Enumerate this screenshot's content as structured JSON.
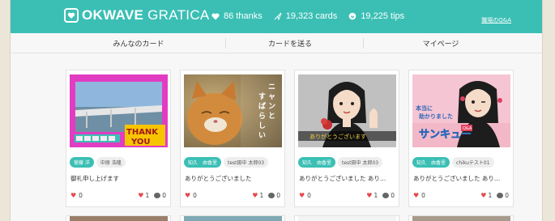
{
  "header": {
    "logo_bold": "OKWAVE",
    "logo_light": "GRATICA",
    "thanks": "86 thanks",
    "cards": "19,323 cards",
    "tips": "19,225 tips",
    "qa_link": "職場のQ&A",
    "brand_color": "#3bbfb5"
  },
  "nav": {
    "items": [
      {
        "label": "みんなのカード"
      },
      {
        "label": "カードを送る"
      },
      {
        "label": "マイページ"
      }
    ]
  },
  "cards": [
    {
      "tags": [
        "菅藤 洋",
        "中原 浩隆"
      ],
      "message": "御礼申し上げます",
      "likes": "0",
      "heart_count": "1",
      "comment_count": "0",
      "image_text": "THANK YOU"
    },
    {
      "tags": [
        "知久　由香里",
        "test田中 太郎03"
      ],
      "message": "ありがとうございました",
      "likes": "0",
      "heart_count": "1",
      "comment_count": "0",
      "image_text": "ニャンと…すばらしい！"
    },
    {
      "tags": [
        "知久　由香里",
        "test田中 太郎03"
      ],
      "message": "ありがとうございました あり…",
      "likes": "0",
      "heart_count": "1",
      "comment_count": "0",
      "image_text": "ありがとうございます"
    },
    {
      "tags": [
        "知久　由香里",
        "chikuテスト01"
      ],
      "message": "ありがとうございました あり…",
      "likes": "0",
      "heart_count": "1",
      "comment_count": "0",
      "image_text": "本当に助かりました サンキュー"
    }
  ]
}
